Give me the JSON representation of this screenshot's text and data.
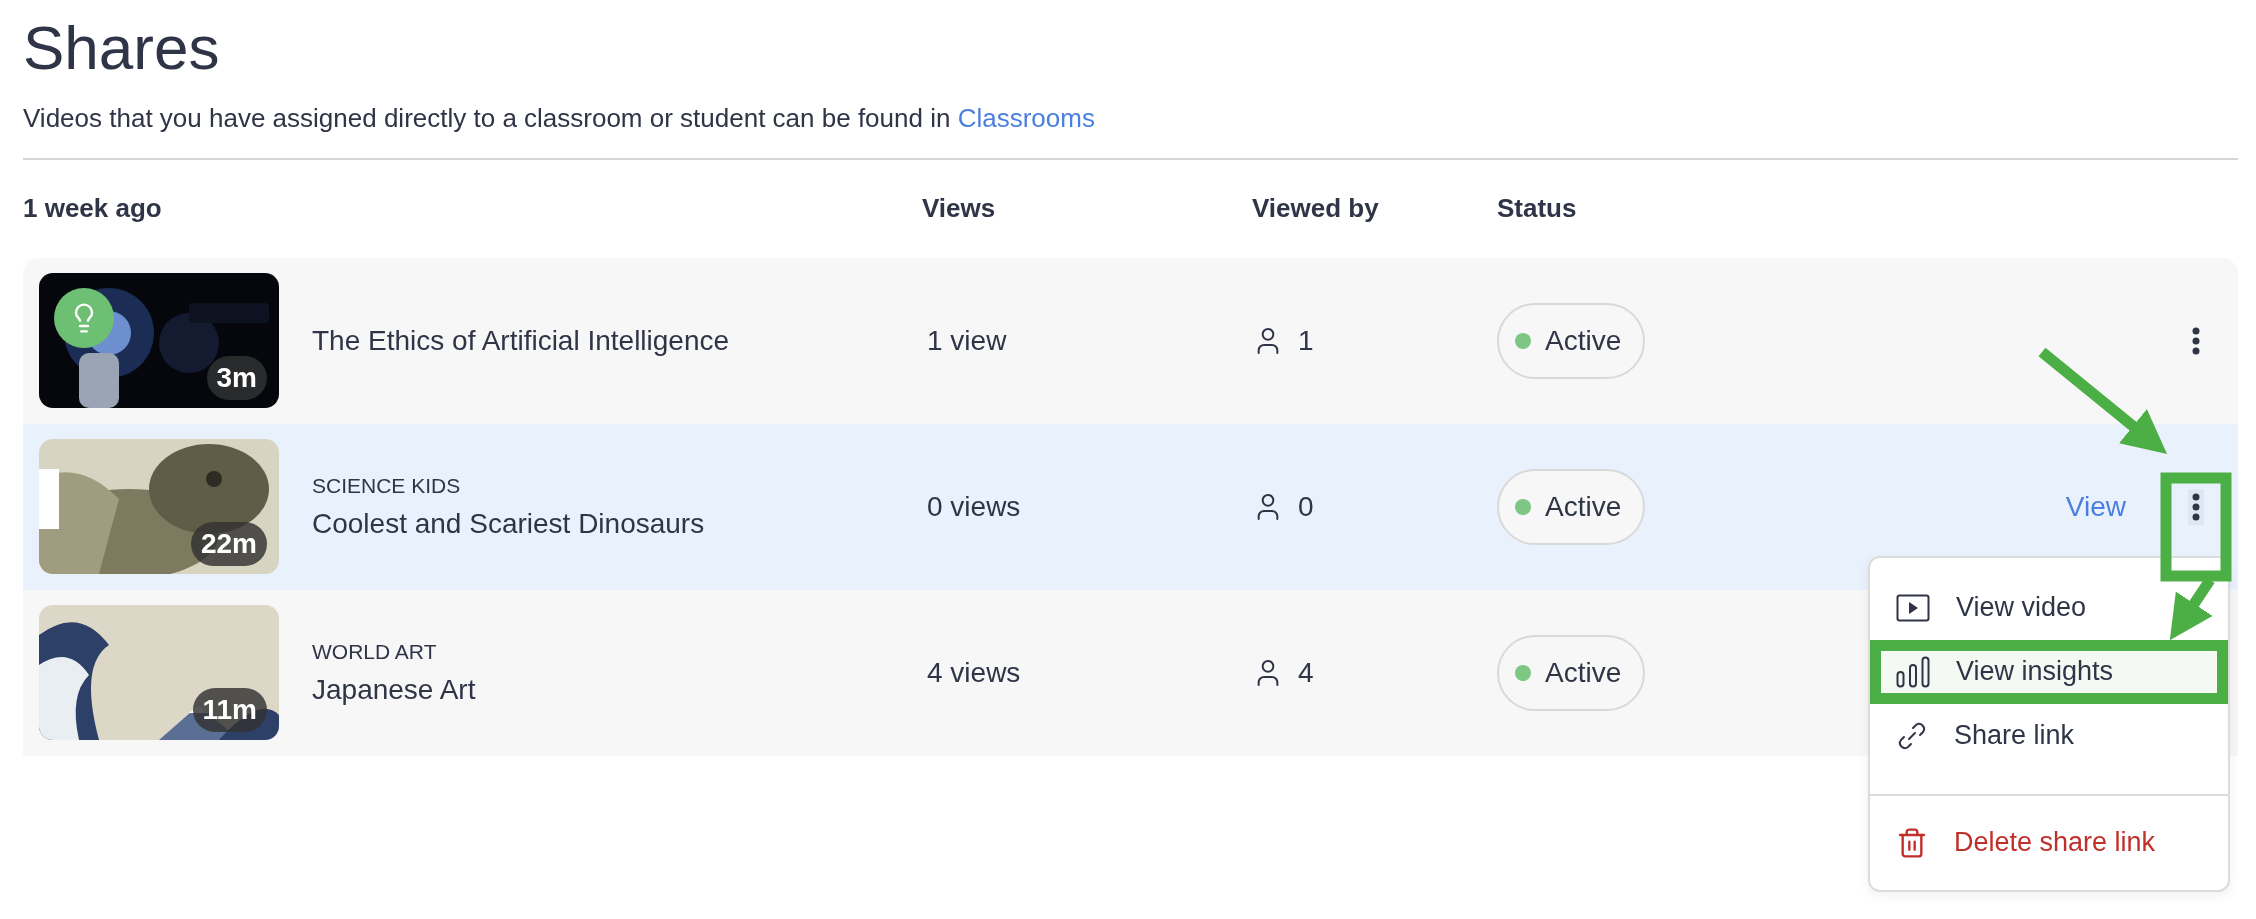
{
  "page": {
    "title": "Shares",
    "subtitle": "Videos that you have assigned directly to a classroom or student can be found in",
    "subtitle_link": "Classrooms"
  },
  "group_label": "1 week ago",
  "columns": [
    "Views",
    "Viewed by",
    "Status"
  ],
  "rows": [
    {
      "duration": "3m",
      "title": "The Ethics of Artificial Intelligence",
      "views": "1 view",
      "viewed_by": "1",
      "status": "Active",
      "selected": false,
      "quiz_badge": true,
      "menu_open": false
    },
    {
      "duration": "22m",
      "channel": "SCIENCE KIDS",
      "title": "Coolest and Scariest Dinosaurs",
      "views": "0 views",
      "viewed_by": "0",
      "status": "Active",
      "selected": true,
      "quiz_badge": false,
      "action_link": "View",
      "menu_open": true
    },
    {
      "duration": "11m",
      "channel": "WORLD ART",
      "title": "Japanese Art",
      "views": "4 views",
      "viewed_by": "4",
      "status": "Active",
      "selected": false,
      "quiz_badge": false,
      "menu_open": false
    }
  ],
  "menu": {
    "items": [
      {
        "kind": "video",
        "label": "View video",
        "highlighted": false
      },
      {
        "kind": "insights",
        "label": "View insights",
        "highlighted": true
      },
      {
        "kind": "link",
        "label": "Share link",
        "highlighted": false
      },
      {
        "kind": "delete",
        "label": "Delete share link",
        "highlighted": false
      }
    ]
  }
}
